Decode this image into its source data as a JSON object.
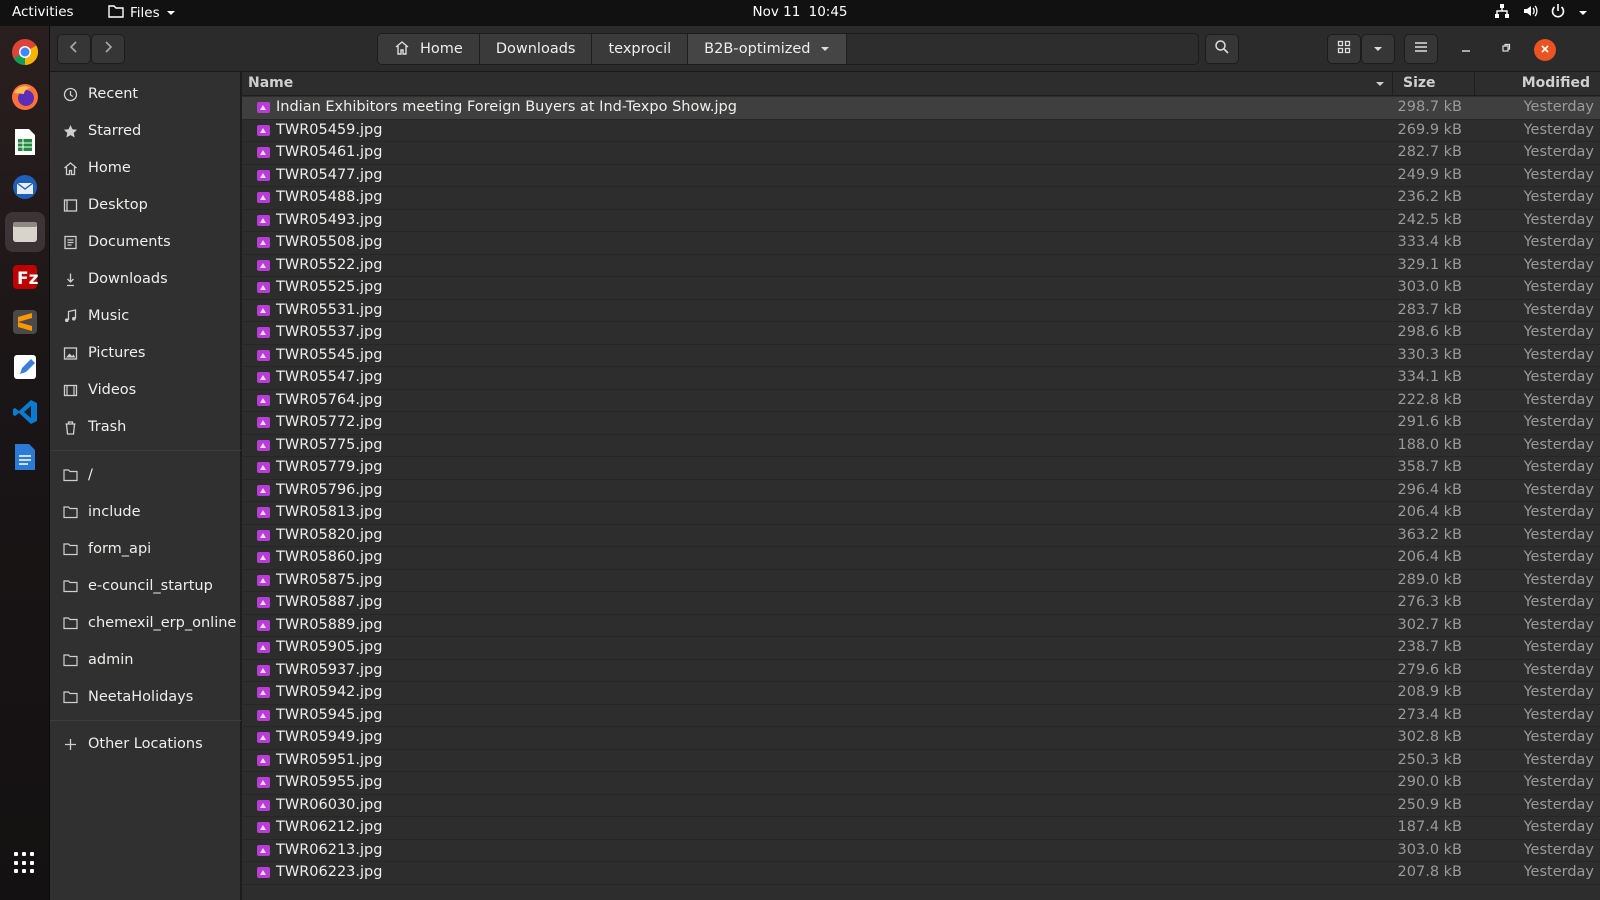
{
  "topbar": {
    "activities": "Activities",
    "app_menu": "Files",
    "date": "Nov 11",
    "time": "10:45"
  },
  "dock": {
    "apps": [
      "chrome-icon",
      "firefox-icon",
      "spreadsheet-icon",
      "thunderbird-icon",
      "files-icon",
      "filezilla-icon",
      "sublime-text-icon",
      "text-editor-icon",
      "vscode-icon",
      "document-icon"
    ],
    "active": "files-icon"
  },
  "path": {
    "crumbs": [
      "Home",
      "Downloads",
      "texprocil",
      "B2B-optimized"
    ]
  },
  "sidebar": {
    "places": [
      {
        "label": "Recent",
        "icon": "clock-icon"
      },
      {
        "label": "Starred",
        "icon": "star-icon"
      },
      {
        "label": "Home",
        "icon": "home-icon"
      },
      {
        "label": "Desktop",
        "icon": "desktop-icon"
      },
      {
        "label": "Documents",
        "icon": "documents-icon"
      },
      {
        "label": "Downloads",
        "icon": "download-icon"
      },
      {
        "label": "Music",
        "icon": "music-icon"
      },
      {
        "label": "Pictures",
        "icon": "pictures-icon"
      },
      {
        "label": "Videos",
        "icon": "videos-icon"
      },
      {
        "label": "Trash",
        "icon": "trash-icon"
      }
    ],
    "bookmarks": [
      {
        "label": "/"
      },
      {
        "label": "include"
      },
      {
        "label": "form_api"
      },
      {
        "label": "e-council_startup"
      },
      {
        "label": "chemexil_erp_online"
      },
      {
        "label": "admin"
      },
      {
        "label": "NeetaHolidays"
      }
    ],
    "other_locations": "Other Locations"
  },
  "columns": {
    "name": "Name",
    "size": "Size",
    "modified": "Modified"
  },
  "files": [
    {
      "name": "Indian Exhibitors meeting Foreign Buyers at Ind-Texpo Show.jpg",
      "size": "298.7 kB",
      "modified": "Yesterday",
      "selected": true
    },
    {
      "name": "TWR05459.jpg",
      "size": "269.9 kB",
      "modified": "Yesterday"
    },
    {
      "name": "TWR05461.jpg",
      "size": "282.7 kB",
      "modified": "Yesterday"
    },
    {
      "name": "TWR05477.jpg",
      "size": "249.9 kB",
      "modified": "Yesterday"
    },
    {
      "name": "TWR05488.jpg",
      "size": "236.2 kB",
      "modified": "Yesterday"
    },
    {
      "name": "TWR05493.jpg",
      "size": "242.5 kB",
      "modified": "Yesterday"
    },
    {
      "name": "TWR05508.jpg",
      "size": "333.4 kB",
      "modified": "Yesterday"
    },
    {
      "name": "TWR05522.jpg",
      "size": "329.1 kB",
      "modified": "Yesterday"
    },
    {
      "name": "TWR05525.jpg",
      "size": "303.0 kB",
      "modified": "Yesterday"
    },
    {
      "name": "TWR05531.jpg",
      "size": "283.7 kB",
      "modified": "Yesterday"
    },
    {
      "name": "TWR05537.jpg",
      "size": "298.6 kB",
      "modified": "Yesterday"
    },
    {
      "name": "TWR05545.jpg",
      "size": "330.3 kB",
      "modified": "Yesterday"
    },
    {
      "name": "TWR05547.jpg",
      "size": "334.1 kB",
      "modified": "Yesterday"
    },
    {
      "name": "TWR05764.jpg",
      "size": "222.8 kB",
      "modified": "Yesterday"
    },
    {
      "name": "TWR05772.jpg",
      "size": "291.6 kB",
      "modified": "Yesterday"
    },
    {
      "name": "TWR05775.jpg",
      "size": "188.0 kB",
      "modified": "Yesterday"
    },
    {
      "name": "TWR05779.jpg",
      "size": "358.7 kB",
      "modified": "Yesterday"
    },
    {
      "name": "TWR05796.jpg",
      "size": "296.4 kB",
      "modified": "Yesterday"
    },
    {
      "name": "TWR05813.jpg",
      "size": "206.4 kB",
      "modified": "Yesterday"
    },
    {
      "name": "TWR05820.jpg",
      "size": "363.2 kB",
      "modified": "Yesterday"
    },
    {
      "name": "TWR05860.jpg",
      "size": "206.4 kB",
      "modified": "Yesterday"
    },
    {
      "name": "TWR05875.jpg",
      "size": "289.0 kB",
      "modified": "Yesterday"
    },
    {
      "name": "TWR05887.jpg",
      "size": "276.3 kB",
      "modified": "Yesterday"
    },
    {
      "name": "TWR05889.jpg",
      "size": "302.7 kB",
      "modified": "Yesterday"
    },
    {
      "name": "TWR05905.jpg",
      "size": "238.7 kB",
      "modified": "Yesterday"
    },
    {
      "name": "TWR05937.jpg",
      "size": "279.6 kB",
      "modified": "Yesterday"
    },
    {
      "name": "TWR05942.jpg",
      "size": "208.9 kB",
      "modified": "Yesterday"
    },
    {
      "name": "TWR05945.jpg",
      "size": "273.4 kB",
      "modified": "Yesterday"
    },
    {
      "name": "TWR05949.jpg",
      "size": "302.8 kB",
      "modified": "Yesterday"
    },
    {
      "name": "TWR05951.jpg",
      "size": "250.3 kB",
      "modified": "Yesterday"
    },
    {
      "name": "TWR05955.jpg",
      "size": "290.0 kB",
      "modified": "Yesterday"
    },
    {
      "name": "TWR06030.jpg",
      "size": "250.9 kB",
      "modified": "Yesterday"
    },
    {
      "name": "TWR06212.jpg",
      "size": "187.4 kB",
      "modified": "Yesterday"
    },
    {
      "name": "TWR06213.jpg",
      "size": "303.0 kB",
      "modified": "Yesterday"
    },
    {
      "name": "TWR06223.jpg",
      "size": "207.8 kB",
      "modified": "Yesterday"
    }
  ],
  "colors": {
    "accent_close": "#e95420",
    "image_file": "#b73dd6"
  }
}
